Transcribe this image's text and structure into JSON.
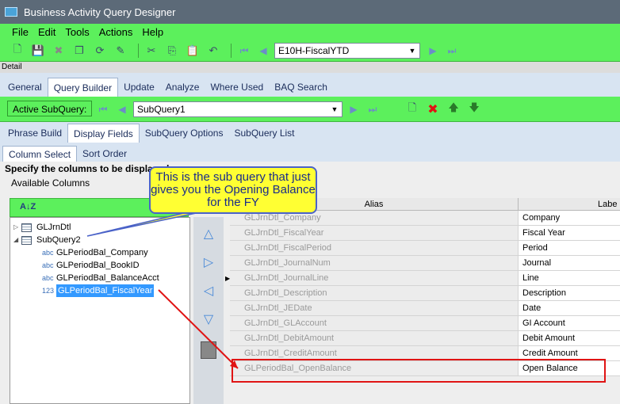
{
  "window": {
    "title": "Business Activity Query Designer"
  },
  "menu": [
    "File",
    "Edit",
    "Tools",
    "Actions",
    "Help"
  ],
  "toolbar": {
    "query_id": "E10H-FiscalYTD"
  },
  "detail_label": "Detail",
  "main_tabs": [
    {
      "label": "General",
      "active": false
    },
    {
      "label": "Query Builder",
      "active": true
    },
    {
      "label": "Update",
      "active": false
    },
    {
      "label": "Analyze",
      "active": false
    },
    {
      "label": "Where Used",
      "active": false
    },
    {
      "label": "BAQ Search",
      "active": false
    }
  ],
  "subquery": {
    "label": "Active SubQuery:",
    "value": "SubQuery1"
  },
  "sub_tabs": [
    {
      "label": "Phrase Build",
      "active": false
    },
    {
      "label": "Display Fields",
      "active": true
    },
    {
      "label": "SubQuery Options",
      "active": false
    },
    {
      "label": "SubQuery List",
      "active": false
    }
  ],
  "inner_tabs": [
    {
      "label": "Column Select",
      "active": true
    },
    {
      "label": "Sort Order",
      "active": false
    }
  ],
  "instruction": "Specify the columns to be displayed",
  "available_columns_label": "Available Columns",
  "tree": {
    "GLJrnDtl": "GLJrnDtl",
    "SubQuery2": "SubQuery2",
    "fields": [
      {
        "type": "abc",
        "name": "GLPeriodBal_Company"
      },
      {
        "type": "abc",
        "name": "GLPeriodBal_BookID"
      },
      {
        "type": "abc",
        "name": "GLPeriodBal_BalanceAcct"
      },
      {
        "type": "123",
        "name": "GLPeriodBal_FiscalYear"
      }
    ]
  },
  "grid": {
    "headers": {
      "alias": "Alias",
      "label": "Labe"
    },
    "rows": [
      {
        "alias": "GLJrnDtl_Company",
        "label": "Company"
      },
      {
        "alias": "GLJrnDtl_FiscalYear",
        "label": "Fiscal Year"
      },
      {
        "alias": "GLJrnDtl_FiscalPeriod",
        "label": "Period"
      },
      {
        "alias": "GLJrnDtl_JournalNum",
        "label": "Journal"
      },
      {
        "alias": "GLJrnDtl_JournalLine",
        "label": "Line"
      },
      {
        "alias": "GLJrnDtl_Description",
        "label": "Description"
      },
      {
        "alias": "GLJrnDtl_JEDate",
        "label": "Date"
      },
      {
        "alias": "GLJrnDtl_GLAccount",
        "label": "GI Account"
      },
      {
        "alias": "GLJrnDtl_DebitAmount",
        "label": "Debit Amount"
      },
      {
        "alias": "GLJrnDtl_CreditAmount",
        "label": "Credit Amount"
      },
      {
        "alias": "GLPeriodBal_OpenBalance",
        "label": "Open Balance"
      }
    ]
  },
  "callout": {
    "text": "This is the sub query that just gives you the Opening Balance for the FY"
  },
  "colors": {
    "accent_green": "#5cf05c",
    "callout_yellow": "#ffff33",
    "highlight_red": "#e01414"
  }
}
